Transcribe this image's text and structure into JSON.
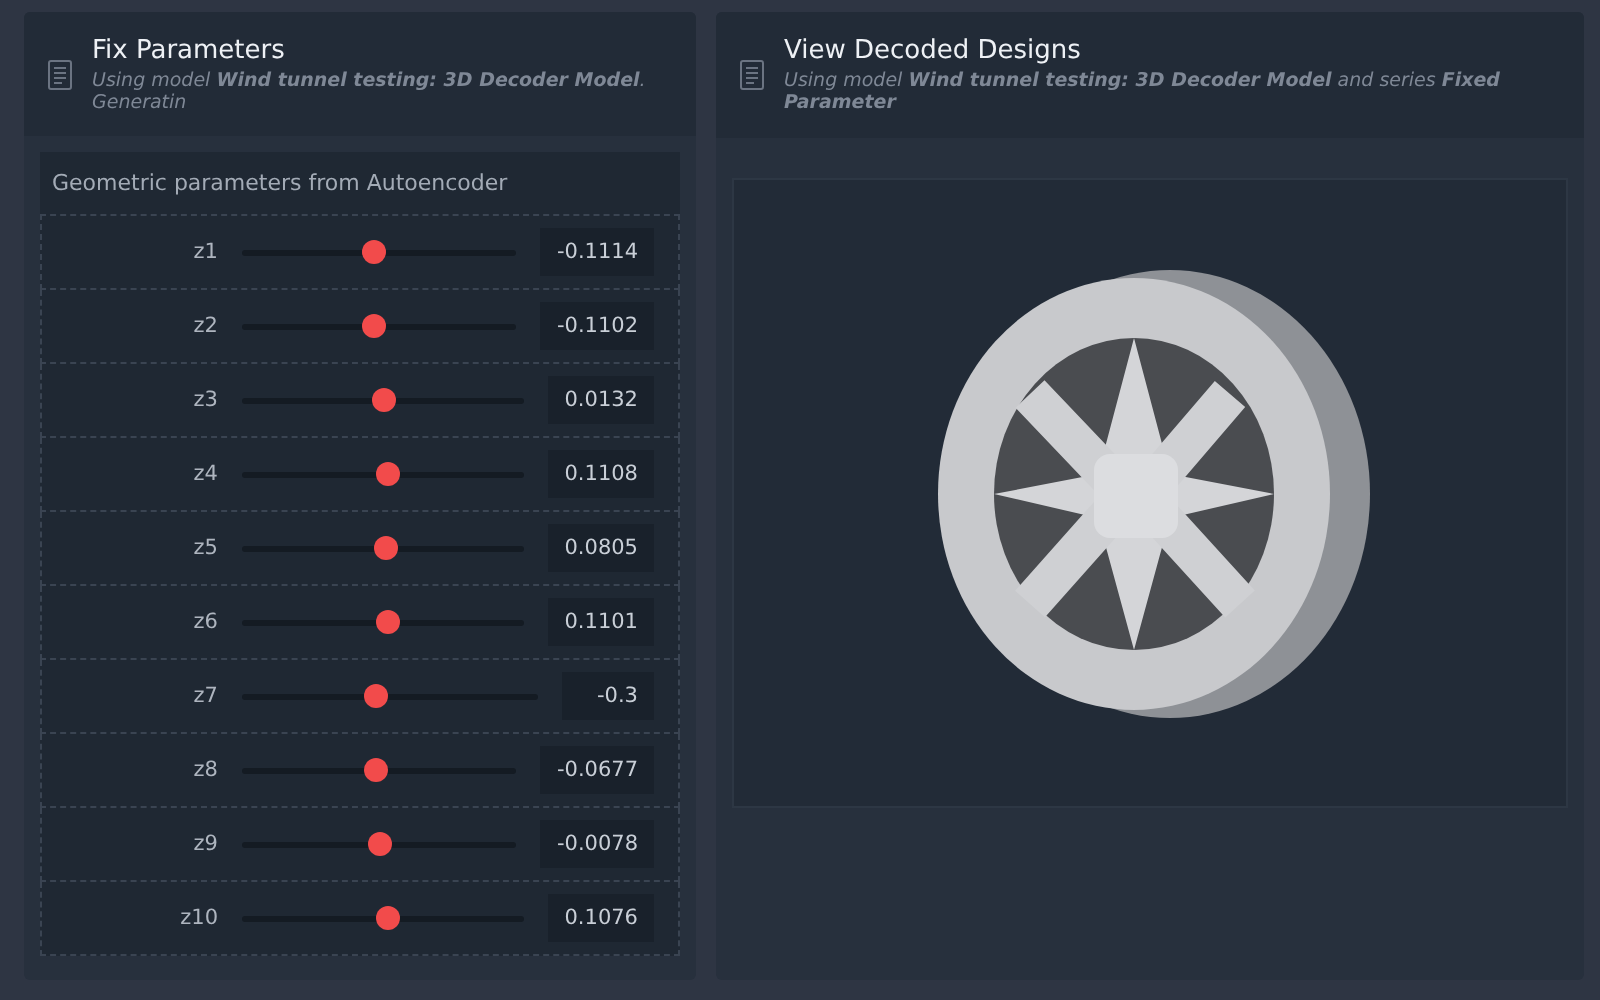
{
  "left_panel": {
    "title": "Fix Parameters",
    "subtitle": "Using model  **Wind tunnel testing: 3D Decoder Model**. Generatin",
    "section_title": "Geometric parameters from Autoencoder",
    "parameters": [
      {
        "label": "z1",
        "level": 0.48,
        "value": "-0.1114"
      },
      {
        "label": "z2",
        "level": 0.48,
        "value": "-0.1102"
      },
      {
        "label": "z3",
        "level": 0.5,
        "value": "0.0132"
      },
      {
        "label": "z4",
        "level": 0.52,
        "value": "0.1108"
      },
      {
        "label": "z5",
        "level": 0.51,
        "value": "0.0805"
      },
      {
        "label": "z6",
        "level": 0.52,
        "value": "0.1101"
      },
      {
        "label": "z7",
        "level": 0.45,
        "value": "-0.3"
      },
      {
        "label": "z8",
        "level": 0.49,
        "value": "-0.0677"
      },
      {
        "label": "z9",
        "level": 0.5,
        "value": "-0.0078"
      },
      {
        "label": "z10",
        "level": 0.52,
        "value": "0.1076"
      }
    ]
  },
  "right_panel": {
    "title": "View Decoded Designs",
    "subtitle": "Using model  **Wind tunnel testing: 3D Decoder Model**  and series  **Fixed Parameter**"
  }
}
